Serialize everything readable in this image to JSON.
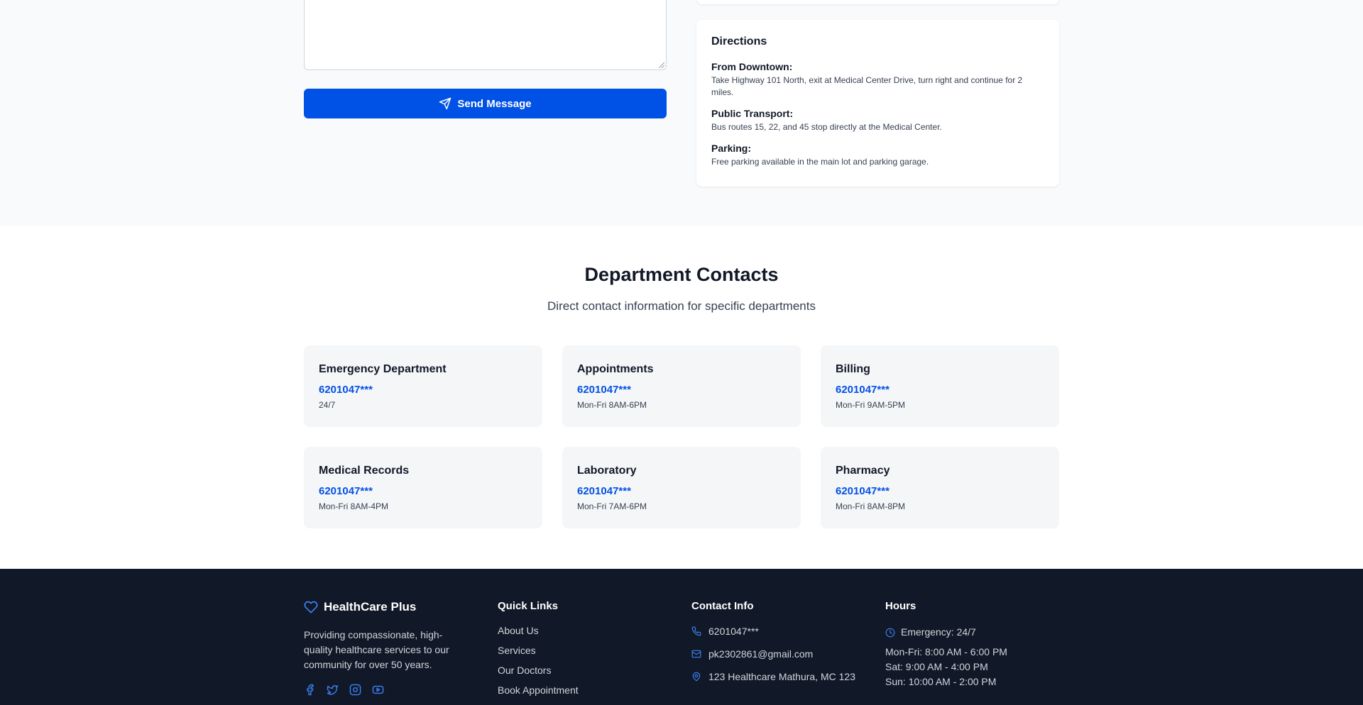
{
  "contact_form": {
    "send_button_label": "Send Message"
  },
  "directions": {
    "title": "Directions",
    "items": [
      {
        "label": "From Downtown:",
        "text": "Take Highway 101 North, exit at Medical Center Drive, turn right and continue for 2 miles."
      },
      {
        "label": "Public Transport:",
        "text": "Bus routes 15, 22, and 45 stop directly at the Medical Center."
      },
      {
        "label": "Parking:",
        "text": "Free parking available in the main lot and parking garage."
      }
    ]
  },
  "departments": {
    "title": "Department Contacts",
    "subtitle": "Direct contact information for specific departments",
    "items": [
      {
        "name": "Emergency Department",
        "phone": "6201047***",
        "hours": "24/7"
      },
      {
        "name": "Appointments",
        "phone": "6201047***",
        "hours": "Mon-Fri 8AM-6PM"
      },
      {
        "name": "Billing",
        "phone": "6201047***",
        "hours": "Mon-Fri 9AM-5PM"
      },
      {
        "name": "Medical Records",
        "phone": "6201047***",
        "hours": "Mon-Fri 8AM-4PM"
      },
      {
        "name": "Laboratory",
        "phone": "6201047***",
        "hours": "Mon-Fri 7AM-6PM"
      },
      {
        "name": "Pharmacy",
        "phone": "6201047***",
        "hours": "Mon-Fri 8AM-8PM"
      }
    ]
  },
  "footer": {
    "brand_name": "HealthCare Plus",
    "brand_description": "Providing compassionate, high-quality healthcare services to our community for over 50 years.",
    "social_icons": [
      "facebook-icon",
      "twitter-icon",
      "instagram-icon",
      "youtube-icon"
    ],
    "quick_links_title": "Quick Links",
    "quick_links": [
      "About Us",
      "Services",
      "Our Doctors",
      "Book Appointment"
    ],
    "contact_title": "Contact Info",
    "contact": {
      "phone": "6201047***",
      "email": "pk2302861@gmail.com",
      "address": "123 Healthcare Mathura, MC 123"
    },
    "hours_title": "Hours",
    "hours": {
      "emergency": "Emergency: 24/7",
      "weekday": "Mon-Fri: 8:00 AM - 6:00 PM",
      "saturday": "Sat: 9:00 AM - 4:00 PM",
      "sunday": "Sun: 10:00 AM - 2:00 PM"
    }
  },
  "colors": {
    "primary": "#0051e6",
    "footer_bg": "#111827",
    "section_bg": "#f9fafb",
    "icon_accent": "#3b82f6"
  }
}
